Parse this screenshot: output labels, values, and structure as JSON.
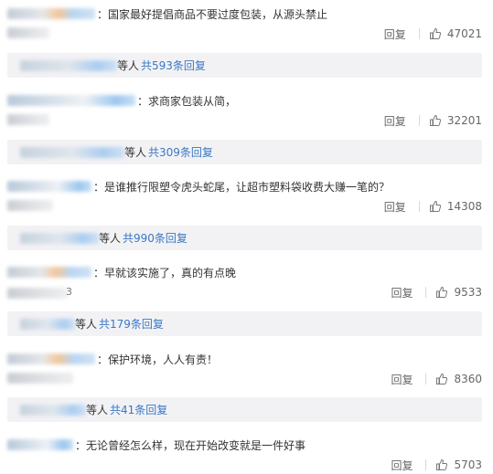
{
  "comments": [
    {
      "text": "：国家最好提倡商品不要过度包装，从源头禁止",
      "reply_label": "回复",
      "likes": "47021",
      "thread": {
        "who_suffix": "等人",
        "replies_link": "共593条回复"
      }
    },
    {
      "text": "：求商家包装从简，",
      "reply_label": "回复",
      "likes": "32201",
      "thread": {
        "who_suffix": "等人",
        "replies_link": "共309条回复"
      }
    },
    {
      "text": "：是谁推行限塑令虎头蛇尾，让超市塑料袋收费大赚一笔的？",
      "reply_label": "回复",
      "likes": "14308",
      "thread": {
        "who_suffix": "等人",
        "replies_link": "共990条回复"
      }
    },
    {
      "text": "：早就该实施了，真的有点晚",
      "meta_suffix": "3",
      "reply_label": "回复",
      "likes": "9533",
      "thread": {
        "who_suffix": "等人",
        "replies_link": "共179条回复"
      }
    },
    {
      "text": "：保护环境，人人有责！",
      "reply_label": "回复",
      "likes": "8360",
      "thread": {
        "who_suffix": "等人",
        "replies_link": "共41条回复"
      }
    },
    {
      "text": "：无论曾经怎么样，现在开始改变就是一件好事",
      "reply_label": "回复",
      "likes": "5703"
    }
  ],
  "icons": {
    "like": "thumbs-up-icon"
  },
  "colors": {
    "link": "#3a78c3",
    "thread_bg": "#f2f2f5",
    "text": "#333333",
    "muted": "#666666"
  }
}
